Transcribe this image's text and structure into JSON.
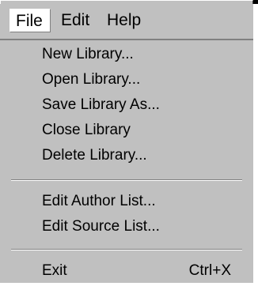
{
  "menubar": {
    "items": [
      {
        "label": "File",
        "active": true
      },
      {
        "label": "Edit",
        "active": false
      },
      {
        "label": "Help",
        "active": false
      }
    ]
  },
  "file_menu": {
    "items": [
      {
        "label": "New Library...",
        "shortcut": ""
      },
      {
        "label": "Open Library...",
        "shortcut": ""
      },
      {
        "label": "Save Library As...",
        "shortcut": ""
      },
      {
        "label": "Close Library",
        "shortcut": ""
      },
      {
        "label": "Delete Library...",
        "shortcut": ""
      },
      {
        "label": "Edit Author List...",
        "shortcut": ""
      },
      {
        "label": "Edit Source List...",
        "shortcut": ""
      },
      {
        "label": "Exit",
        "shortcut": "Ctrl+X"
      }
    ]
  },
  "colors": {
    "menu_background": "#c0c0c0",
    "active_menu_background": "#ffffff",
    "text": "#000000",
    "separator_dark": "#808080",
    "separator_light": "#ffffff"
  }
}
